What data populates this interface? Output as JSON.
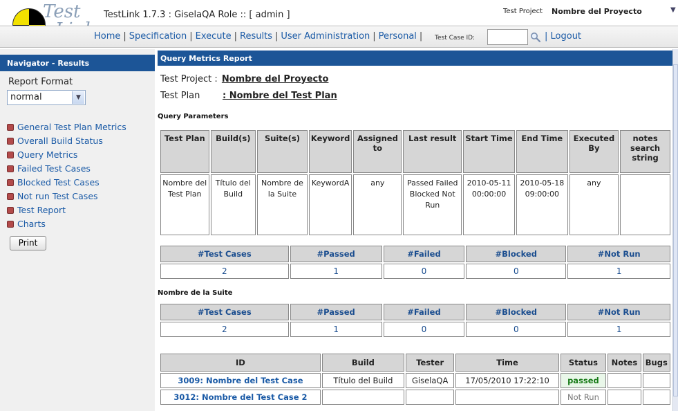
{
  "header": {
    "logo_word1": "Test",
    "logo_word2": "Link",
    "app_title": "TestLink 1.7.3 : GiselaQA Role :: [ admin ]",
    "project_label": "Test Project",
    "project_name": "Nombre del Proyecto",
    "menu": [
      "Home",
      "Specification",
      "Execute",
      "Results",
      "User Administration",
      "Personal"
    ],
    "test_case_id_label": "Test Case ID:",
    "test_case_id_value": "",
    "logout_label": "Logout"
  },
  "navigator": {
    "title": "Navigator - Results",
    "report_format_label": "Report Format",
    "report_format_value": "normal",
    "items": [
      "General Test Plan Metrics",
      "Overall Build Status",
      "Query Metrics",
      "Failed Test Cases",
      "Blocked Test Cases",
      "Not run Test Cases",
      "Test Report",
      "Charts"
    ],
    "print_label": "Print"
  },
  "main": {
    "title": "Query Metrics Report",
    "test_project_label": "Test Project :",
    "test_project_value": "Nombre del Proyecto",
    "test_plan_label": "Test Plan",
    "test_plan_value": ": Nombre del Test Plan",
    "query_params_label": "Query Parameters",
    "params_headers": [
      "Test Plan",
      "Build(s)",
      "Suite(s)",
      "Keyword",
      "Assigned to",
      "Last result",
      "Start Time",
      "End Time",
      "Executed By",
      "notes search string"
    ],
    "params_row": [
      "Nombre del Test Plan",
      "Título del Build",
      "Nombre de la Suite",
      "KeywordA",
      "any",
      "Passed Failed Blocked Not Run",
      "2010-05-11 00:00:00",
      "2010-05-18 09:00:00",
      "any",
      ""
    ],
    "summary_headers": [
      "#Test Cases",
      "#Passed",
      "#Failed",
      "#Blocked",
      "#Not Run"
    ],
    "summary_totals": [
      "2",
      "1",
      "0",
      "0",
      "1"
    ],
    "suite_label": "Nombre de la Suite",
    "suite_totals": [
      "2",
      "1",
      "0",
      "0",
      "1"
    ],
    "tc_headers": [
      "ID",
      "Build",
      "Tester",
      "Time",
      "Status",
      "Notes",
      "Bugs"
    ],
    "tc_rows": [
      [
        "3009: Nombre del Test Case",
        "Título del Build",
        "GiselaQA",
        "17/05/2010 17:22:10",
        "passed",
        "",
        ""
      ],
      [
        "3012: Nombre del Test Case 2",
        "",
        "",
        "",
        "Not Run",
        "",
        ""
      ]
    ]
  },
  "colors": {
    "title_bar": "#1c5597",
    "table_header_bg": "#d6d6d6",
    "link": "#1a5aa6",
    "passed": "#187a18",
    "bullet": "#b24a4a"
  }
}
